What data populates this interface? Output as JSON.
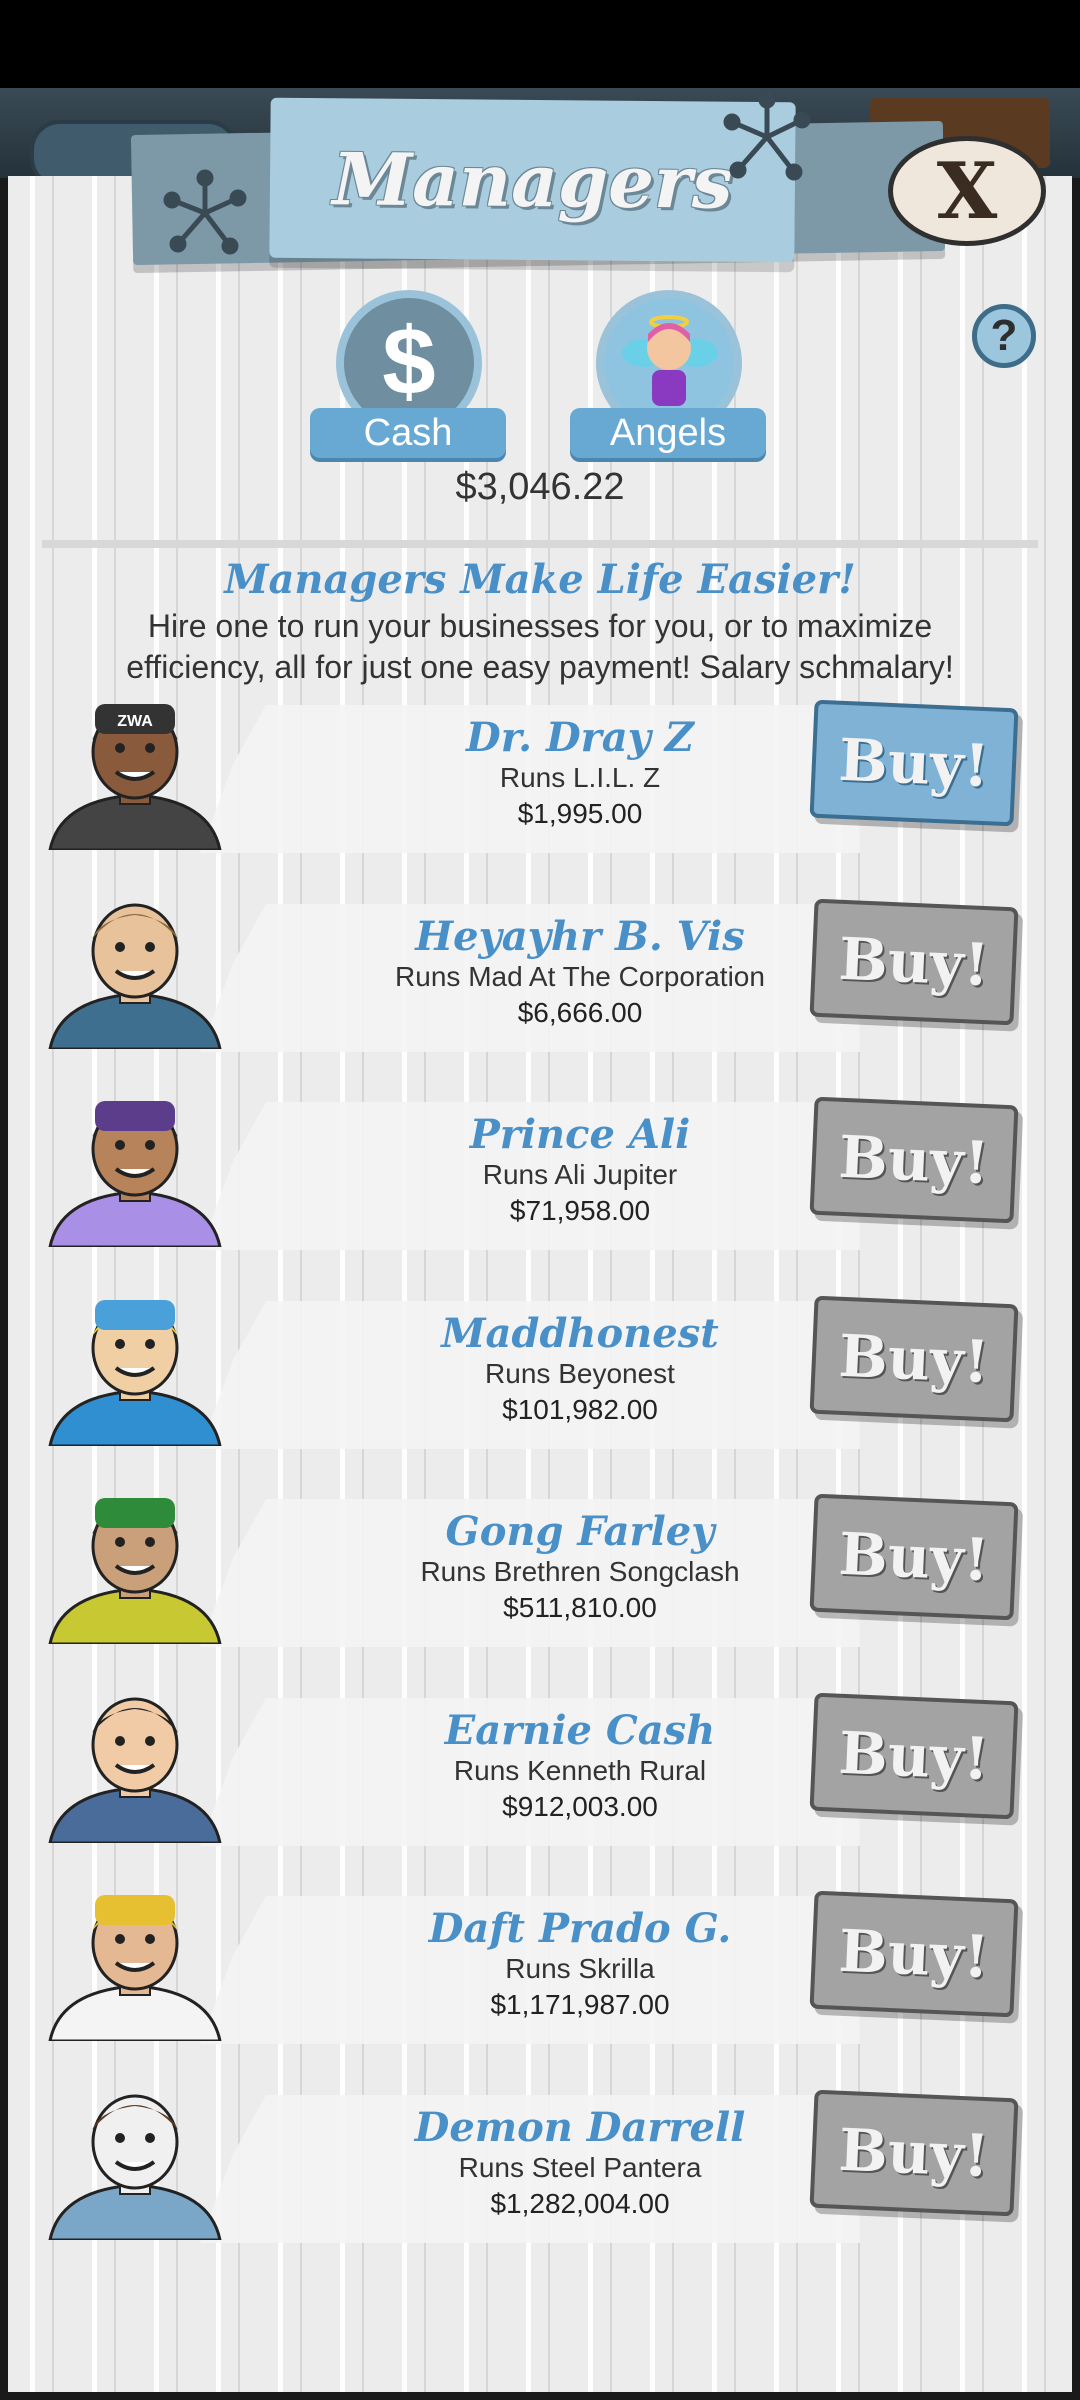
{
  "header": {
    "title": "Managers",
    "close_label": "X",
    "help_label": "?"
  },
  "tabs": [
    {
      "label": "Cash",
      "icon": "dollar-icon",
      "glyph": "$"
    },
    {
      "label": "Angels",
      "icon": "angel-icon"
    }
  ],
  "balance": "$3,046.22",
  "intro": {
    "headline": "Managers Make Life Easier!",
    "text": "Hire one to run your businesses for you, or to maximize efficiency, all for just one easy payment! Salary schmalary!"
  },
  "buy_label": "Buy!",
  "managers": [
    {
      "name": "Dr. Dray Z",
      "runs": "Runs L.I.L. Z",
      "cost": "$1,995.00",
      "affordable": true,
      "cap_text": "ZWA",
      "colors": {
        "skin": "#8a5a3c",
        "hair": "#222222",
        "shirt": "#444444",
        "hat": "#333333"
      }
    },
    {
      "name": "Heyayhr B. Vis",
      "runs": "Runs Mad At The Corporation",
      "cost": "$6,666.00",
      "affordable": false,
      "colors": {
        "skin": "#e8c29a",
        "hair": "#8b6b3a",
        "shirt": "#3f6f8f",
        "hat": ""
      }
    },
    {
      "name": "Prince Ali",
      "runs": "Runs Ali Jupiter",
      "cost": "$71,958.00",
      "affordable": false,
      "colors": {
        "skin": "#b7835a",
        "hair": "#222222",
        "shirt": "#a98fe6",
        "hat": "#5b3d8c"
      }
    },
    {
      "name": "Maddhonest",
      "runs": "Runs Beyonest",
      "cost": "$101,982.00",
      "affordable": false,
      "colors": {
        "skin": "#f1cfa4",
        "hair": "#f0d040",
        "shirt": "#2f8fd0",
        "hat": "#4aa0d8"
      }
    },
    {
      "name": "Gong Farley",
      "runs": "Runs Brethren Songclash",
      "cost": "$511,810.00",
      "affordable": false,
      "colors": {
        "skin": "#caa07a",
        "hair": "#3a2a1c",
        "shirt": "#c8c832",
        "hat": "#2e8b3a"
      }
    },
    {
      "name": "Earnie Cash",
      "runs": "Runs Kenneth Rural",
      "cost": "$912,003.00",
      "affordable": false,
      "colors": {
        "skin": "#f0cba6",
        "hair": "#222222",
        "shirt": "#4a6c9a",
        "hat": ""
      }
    },
    {
      "name": "Daft Prado G.",
      "runs": "Runs Skrilla",
      "cost": "$1,171,987.00",
      "affordable": false,
      "colors": {
        "skin": "#e4b893",
        "hair": "#e6c030",
        "shirt": "#f4f4f4",
        "hat": "#e6c030"
      }
    },
    {
      "name": "Demon Darrell",
      "runs": "Runs Steel Pantera",
      "cost": "$1,282,004.00",
      "affordable": false,
      "colors": {
        "skin": "#f0f0f0",
        "hair": "#5a3a22",
        "shirt": "#7aa6c8",
        "hat": ""
      }
    }
  ]
}
